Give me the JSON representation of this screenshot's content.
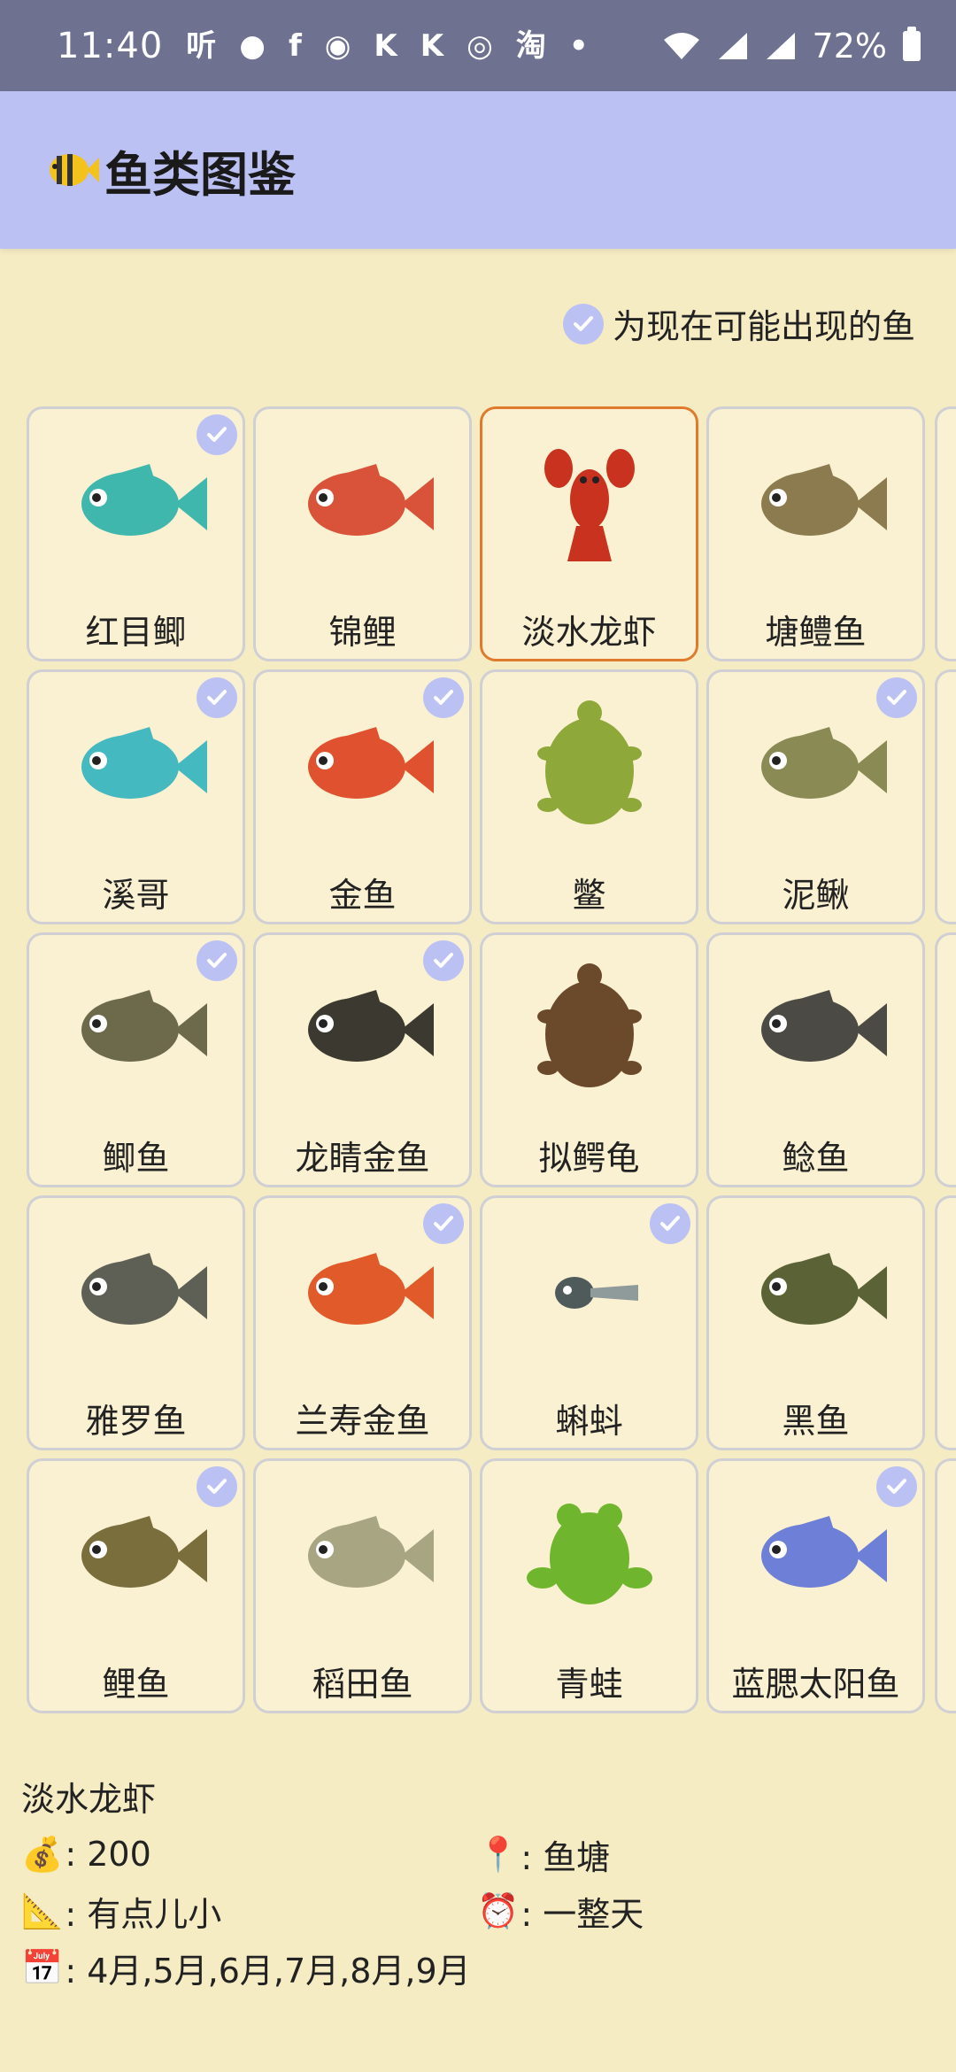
{
  "status_bar": {
    "time": "11:40",
    "icons": [
      "听",
      "message-icon",
      "facebook-icon",
      "weibo-icon",
      "K",
      "K",
      "target-icon",
      "淘",
      "•"
    ],
    "battery": "72%"
  },
  "app_bar": {
    "icon": "tropical-fish-icon",
    "title": "鱼类图鉴"
  },
  "legend": {
    "text": "为现在可能出现的鱼"
  },
  "accent_colors": {
    "app_bar": "#bcc1f4",
    "background": "#f6ecc4",
    "selected_border": "#e07a2c",
    "card_border": "#cfcfd4"
  },
  "creatures": [
    {
      "name": "红目鲫",
      "available": true,
      "selected": false,
      "kind": "fish",
      "color": "#3fb7ad"
    },
    {
      "name": "锦鲤",
      "available": false,
      "selected": false,
      "kind": "fish",
      "color": "#d9533a"
    },
    {
      "name": "淡水龙虾",
      "available": false,
      "selected": true,
      "kind": "lobster",
      "color": "#c9321f"
    },
    {
      "name": "塘鳢鱼",
      "available": false,
      "selected": false,
      "kind": "fish",
      "color": "#8b7b4e"
    },
    {
      "name": "溪哥",
      "available": true,
      "selected": false,
      "kind": "fish",
      "color": "#45b9c0"
    },
    {
      "name": "金鱼",
      "available": true,
      "selected": false,
      "kind": "fish",
      "color": "#e0522f"
    },
    {
      "name": "鳖",
      "available": false,
      "selected": false,
      "kind": "turtle",
      "color": "#8fa83a"
    },
    {
      "name": "泥鳅",
      "available": true,
      "selected": false,
      "kind": "fish",
      "color": "#8a8a55"
    },
    {
      "name": "鲫鱼",
      "available": true,
      "selected": false,
      "kind": "fish",
      "color": "#6c6a4a"
    },
    {
      "name": "龙睛金鱼",
      "available": true,
      "selected": false,
      "kind": "fish",
      "color": "#3c3a30"
    },
    {
      "name": "拟鳄龟",
      "available": false,
      "selected": false,
      "kind": "turtle",
      "color": "#6b4a2b"
    },
    {
      "name": "鲶鱼",
      "available": false,
      "selected": false,
      "kind": "fish",
      "color": "#4c4a44"
    },
    {
      "name": "雅罗鱼",
      "available": false,
      "selected": false,
      "kind": "fish",
      "color": "#5f6055"
    },
    {
      "name": "兰寿金鱼",
      "available": true,
      "selected": false,
      "kind": "fish",
      "color": "#e05a2a"
    },
    {
      "name": "蝌蚪",
      "available": true,
      "selected": false,
      "kind": "tadpole",
      "color": "#4f5a5a"
    },
    {
      "name": "黑鱼",
      "available": false,
      "selected": false,
      "kind": "fish",
      "color": "#5a6236"
    },
    {
      "name": "鲤鱼",
      "available": true,
      "selected": false,
      "kind": "fish",
      "color": "#7a6e3c"
    },
    {
      "name": "稻田鱼",
      "available": false,
      "selected": false,
      "kind": "fish",
      "color": "#a8a582"
    },
    {
      "name": "青蛙",
      "available": false,
      "selected": false,
      "kind": "frog",
      "color": "#6fb52e"
    },
    {
      "name": "蓝腮太阳鱼",
      "available": true,
      "selected": false,
      "kind": "fish",
      "color": "#6d7fd6"
    }
  ],
  "details": {
    "name": "淡水龙虾",
    "price_icon": "💰",
    "price": ": 200",
    "location_icon": "📍",
    "location": ": 鱼塘",
    "size_icon": "📐",
    "size": ": 有点儿小",
    "time_icon": "⏰",
    "time": ": 一整天",
    "months_icon": "📅",
    "months": ": 4月,5月,6月,7月,8月,9月"
  }
}
